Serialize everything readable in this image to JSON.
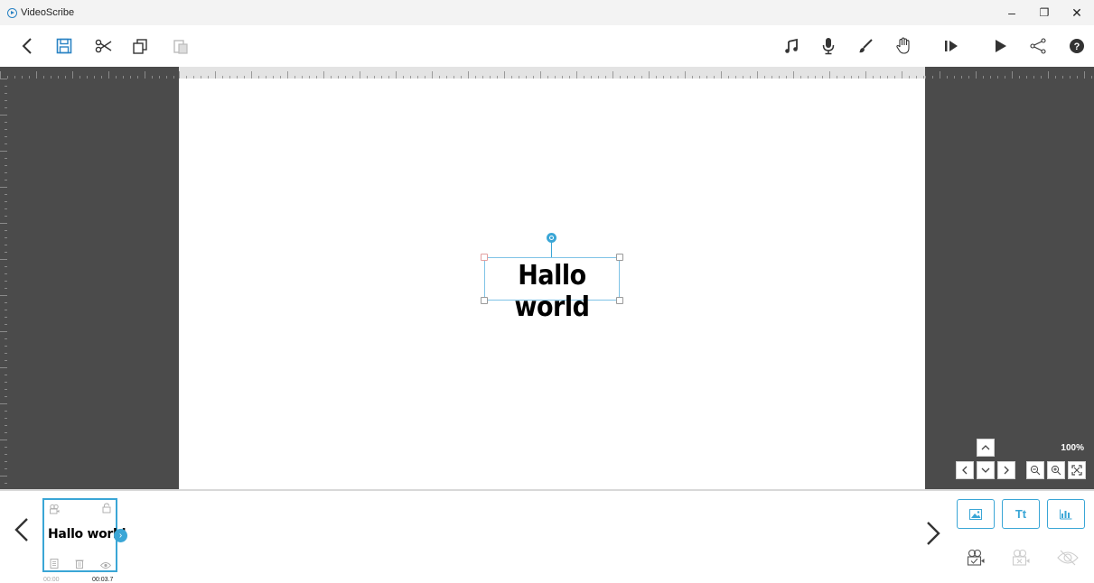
{
  "window": {
    "title": "VideoScribe",
    "minimize_label": "–",
    "restore_label": "❐",
    "close_label": "✕"
  },
  "toolbar": {
    "left_icons": [
      "back-icon",
      "save-icon",
      "cut-icon",
      "copy-icon",
      "paste-icon"
    ],
    "right_icons": [
      "music-icon",
      "microphone-icon",
      "brush-icon",
      "hand-icon",
      "play-from-icon",
      "play-icon",
      "share-icon",
      "help-icon"
    ]
  },
  "canvas": {
    "text": "Hallo world"
  },
  "view_controls": {
    "zoom_level": "100%"
  },
  "timeline": {
    "prev_label": "<",
    "next_label": ">",
    "thumbnail": {
      "text": "Hallo world",
      "start_time": "00:00",
      "end_time": "00:03.7"
    },
    "add_text_label": "Tt"
  },
  "colors": {
    "accent": "#3aa6d6",
    "stage": "#4b4b4b",
    "canvas": "#ffffff"
  }
}
